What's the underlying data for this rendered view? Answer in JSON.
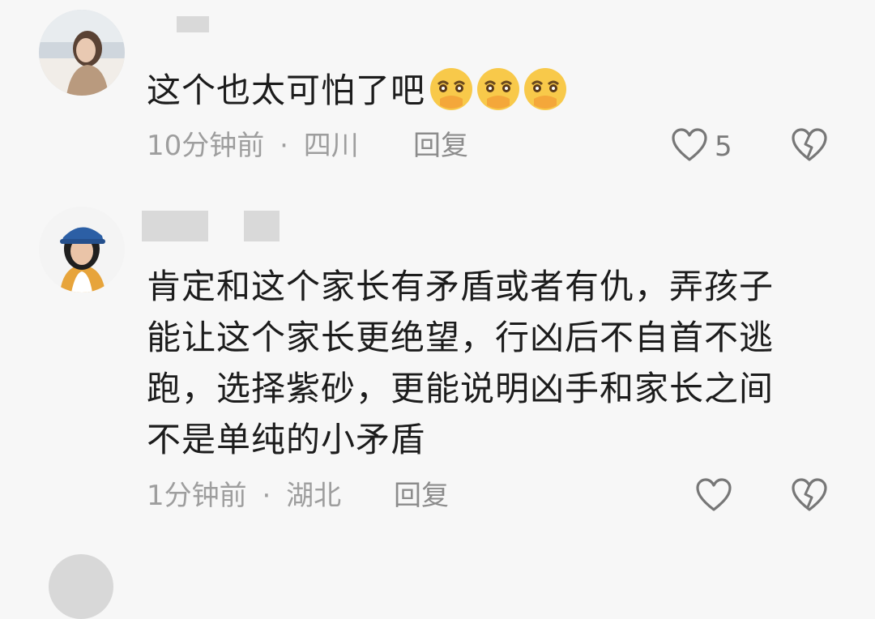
{
  "comments": [
    {
      "username": "",
      "text": "这个也太可怕了吧",
      "emoji_icons": [
        "crying-face-icon",
        "crying-face-icon",
        "crying-face-icon"
      ],
      "time": "10分钟前",
      "location": "四川",
      "separator": "·",
      "reply_label": "回复",
      "like_count": "5"
    },
    {
      "username": "",
      "lines": [
        "肯定和这个家长有矛盾或者有仇，弄孩子",
        "能让这个家长更绝望，行凶后不自首不逃",
        "跑，选择紫砂，更能说明凶手和家长之间",
        "不是单纯的小矛盾"
      ],
      "time": "1分钟前",
      "location": "湖北",
      "separator": "·",
      "reply_label": "回复",
      "like_count": ""
    }
  ],
  "colors": {
    "background": "#f7f7f7",
    "text": "#1c1c1c",
    "meta": "#9e9e9e",
    "icon_stroke": "#777777"
  }
}
